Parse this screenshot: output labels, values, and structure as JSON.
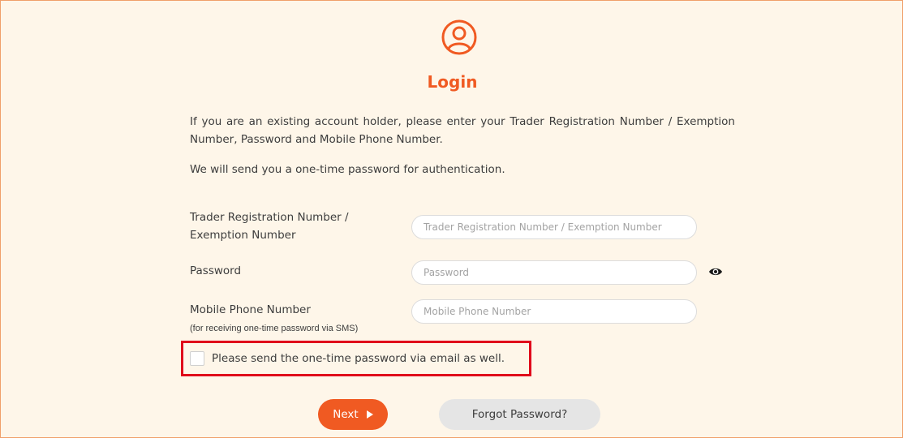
{
  "colors": {
    "accent": "#f05a22",
    "panel_background": "#fef6e9",
    "panel_border": "#f0a06a",
    "highlight": "#e0001b",
    "secondary_button": "#e5e5e5"
  },
  "header": {
    "icon": "user-circle-icon",
    "title": "Login"
  },
  "intro": {
    "instructions": "If you are an existing account holder, please enter your Trader Registration Number / Exemption Number, Password and Mobile Phone Number.",
    "otp_note": "We will send you a one-time password for authentication."
  },
  "form": {
    "trader": {
      "label": "Trader Registration Number / Exemption Number",
      "placeholder": "Trader Registration Number / Exemption Number",
      "value": ""
    },
    "password": {
      "label": "Password",
      "placeholder": "Password",
      "value": "",
      "toggle_icon": "eye-icon"
    },
    "mobile": {
      "label": "Mobile Phone Number",
      "sublabel": "(for receiving one-time password via SMS)",
      "placeholder": "Mobile Phone Number",
      "value": ""
    },
    "email_otp": {
      "label": "Please send the one-time password via email as well.",
      "checked": false
    }
  },
  "actions": {
    "next_label": "Next",
    "next_icon": "arrow-right-icon",
    "forgot_label": "Forgot Password?"
  }
}
